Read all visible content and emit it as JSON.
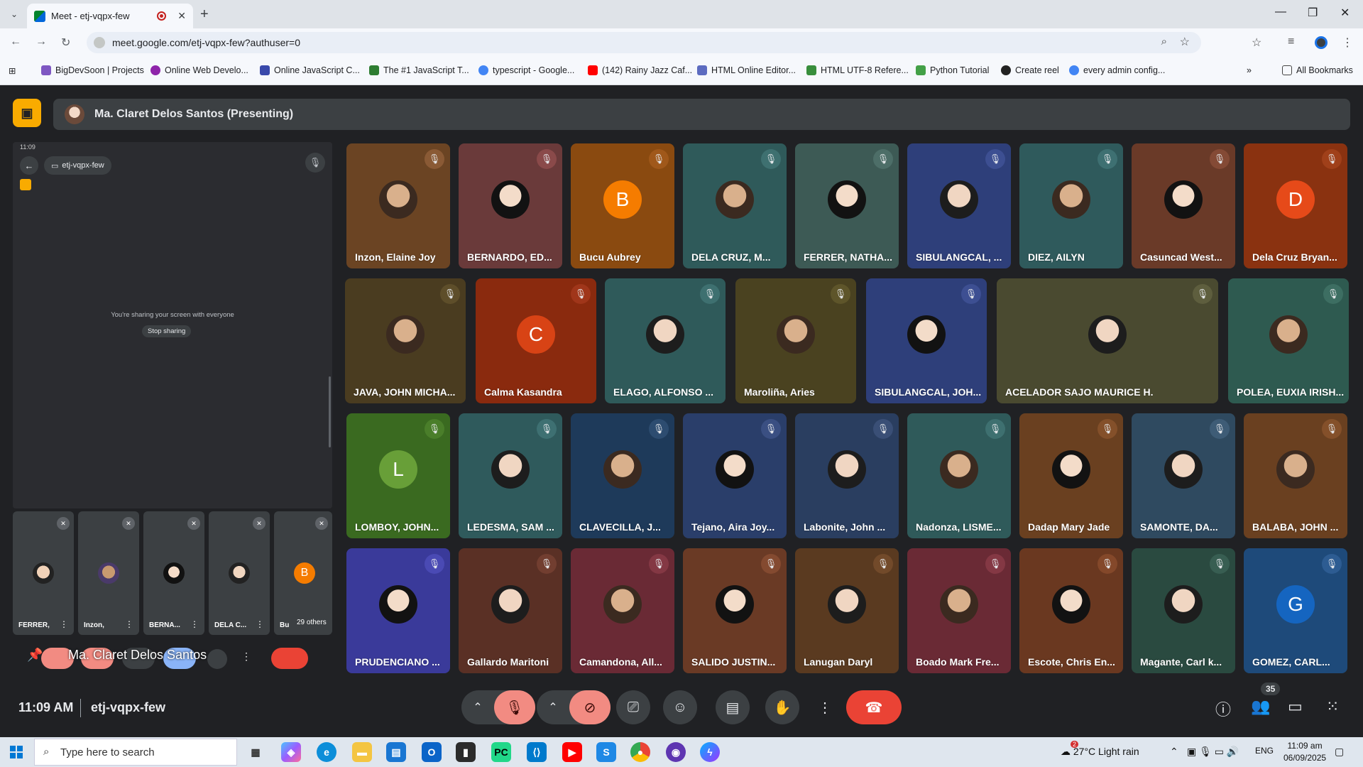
{
  "browser": {
    "tab_title": "Meet - etj-vqpx-few",
    "url": "meet.google.com/etj-vqpx-few?authuser=0",
    "bookmarks": [
      "BigDevSoon | Projects",
      "Online Web Develo...",
      "Online JavaScript C...",
      "The #1 JavaScript T...",
      "typescript - Google...",
      "(142) Rainy Jazz Caf...",
      "HTML Online Editor...",
      "HTML UTF-8 Refere...",
      "Python Tutorial",
      "Create reel",
      "every admin config..."
    ],
    "all_bookmarks": "All Bookmarks"
  },
  "meet": {
    "presenter": "Ma. Claret Delos Santos (Presenting)",
    "phone_chip": "etj-vqpx-few",
    "phone_time": "11:09",
    "sharing_text": "You're sharing your screen with everyone",
    "stop_sharing": "Stop sharing",
    "overlay_name": "Ma. Claret Delos Santos",
    "others": "29 others",
    "mini_tiles": [
      {
        "name": "FERRER,",
        "color": "#3c4043"
      },
      {
        "name": "Inzon,",
        "color": "#3c4043"
      },
      {
        "name": "BERNA...",
        "color": "#3c4043"
      },
      {
        "name": "DELA C...",
        "color": "#3c4043"
      },
      {
        "name": "Bu",
        "letter": "B",
        "color": "#f57c00"
      }
    ],
    "tiles": [
      {
        "name": "Inzon, Elaine Joy",
        "bg": "#6b4423",
        "mic": "#8a5a35"
      },
      {
        "name": "BERNARDO, ED...",
        "bg": "#6a3a3a",
        "mic": "#8a4a4a"
      },
      {
        "name": "Bucu Aubrey",
        "bg": "#8a4a10",
        "letter": "B",
        "lc": "#f57c00",
        "mic": "#a0581a"
      },
      {
        "name": "DELA CRUZ, M...",
        "bg": "#2f5a5a",
        "mic": "#3e7070"
      },
      {
        "name": "FERRER, NATHA...",
        "bg": "#3d5a55",
        "mic": "#4d6e68"
      },
      {
        "name": "SIBULANGCAL, ...",
        "bg": "#2e3f7a",
        "mic": "#3d4f92"
      },
      {
        "name": "DIEZ, AILYN",
        "bg": "#2f5a5c",
        "mic": "#3e7072"
      },
      {
        "name": "Casuncad West...",
        "bg": "#6a3a28",
        "mic": "#844a35"
      },
      {
        "name": "Dela Cruz Bryan...",
        "bg": "#8a3210",
        "letter": "D",
        "lc": "#e64a19",
        "mic": "#a0401a"
      },
      {
        "name": "JAVA, JOHN MICHA...",
        "bg": "#4a3c20",
        "mic": "#5e4e2a"
      },
      {
        "name": "Calma Kasandra",
        "bg": "#8a2a0e",
        "letter": "C",
        "lc": "#d84315",
        "mic": "#a0361a"
      },
      {
        "name": "ELAGO, ALFONSO ...",
        "bg": "#2f5a5a",
        "mic": "#3e7070"
      },
      {
        "name": "Maroliña, Aries",
        "bg": "#4a4220",
        "mic": "#5e552a"
      },
      {
        "name": "SIBULANGCAL, JOH...",
        "bg": "#2e3f7a",
        "mic": "#3d4f92"
      },
      {
        "name": "ACELADOR SAJO MAURICE H.",
        "bg": "#4a4a30",
        "mic": "#5e5e3e"
      },
      {
        "name": "POLEA, EUXIA IRISH...",
        "bg": "#2e5a50",
        "mic": "#3d6e62"
      },
      {
        "name": "LOMBOY, JOHN...",
        "bg": "#3a6a20",
        "letter": "L",
        "lc": "#689f38",
        "mic": "#4a7e2a"
      },
      {
        "name": "LEDESMA, SAM ...",
        "bg": "#2f5a5c",
        "mic": "#3e7072"
      },
      {
        "name": "CLAVECILLA, J...",
        "bg": "#1e3a5a",
        "mic": "#2d4c70"
      },
      {
        "name": "Tejano, Aira Joy...",
        "bg": "#2a3e6a",
        "mic": "#3a4f82"
      },
      {
        "name": "Labonite, John ...",
        "bg": "#2a3e60",
        "mic": "#3a4f76"
      },
      {
        "name": "Nadonza, LISME...",
        "bg": "#2f5a5a",
        "mic": "#3e7070"
      },
      {
        "name": "Dadap Mary Jade",
        "bg": "#6a4020",
        "mic": "#84502a"
      },
      {
        "name": "SAMONTE, DA...",
        "bg": "#2f4a60",
        "mic": "#3e5c76"
      },
      {
        "name": "BALABA, JOHN ...",
        "bg": "#6a4020",
        "mic": "#84502a"
      },
      {
        "name": "PRUDENCIANO ...",
        "bg": "#3a3a9a",
        "mic": "#4a4ab4"
      },
      {
        "name": "Gallardo Maritoni",
        "bg": "#5a3025",
        "mic": "#723e30"
      },
      {
        "name": "Camandona, All...",
        "bg": "#6a2a35",
        "mic": "#843844"
      },
      {
        "name": "SALIDO JUSTIN...",
        "bg": "#6a3a25",
        "mic": "#844a30"
      },
      {
        "name": "Lanugan Daryl",
        "bg": "#5a3a20",
        "mic": "#724a2a"
      },
      {
        "name": "Boado Mark Fre...",
        "bg": "#6a2a35",
        "mic": "#843844"
      },
      {
        "name": "Escote, Chris En...",
        "bg": "#6a3820",
        "mic": "#84482a"
      },
      {
        "name": "Magante, Carl k...",
        "bg": "#2a4a40",
        "mic": "#385e52"
      },
      {
        "name": "GOMEZ, CARL...",
        "bg": "#1e4a7a",
        "letter": "G",
        "lc": "#1565c0",
        "mic": "#2d5c92"
      }
    ],
    "time": "11:09 AM",
    "meeting_code": "etj-vqpx-few",
    "participant_count": "35"
  },
  "taskbar": {
    "search_placeholder": "Type here to search",
    "weather": "27°C  Light rain",
    "weather_badge": "2",
    "lang": "ENG",
    "time": "11:09 am",
    "date": "06/09/2025"
  },
  "colors": {
    "accent": "#f9ab00",
    "end_call": "#ea4335",
    "muted": "#f28b82"
  }
}
